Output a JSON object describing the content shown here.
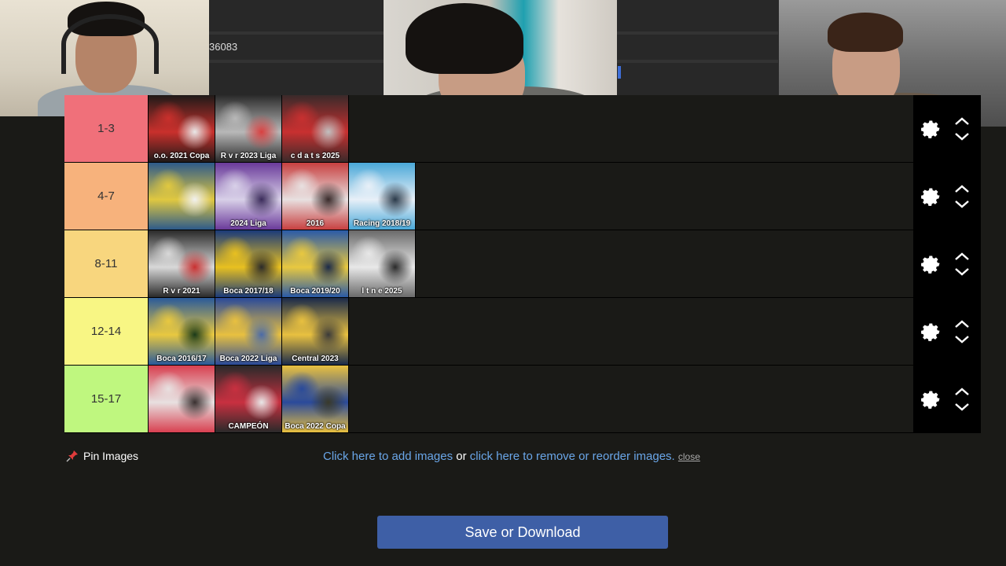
{
  "topbar": {
    "url_fragment": "36083"
  },
  "tiers": [
    {
      "label": "1-3",
      "color": "#f0707a",
      "items": [
        {
          "caption": "o.o. 2021 Copa",
          "palette": [
            "#1f1a18",
            "#c9302c",
            "#e8e8e8"
          ]
        },
        {
          "caption": "R v r 2023 Liga",
          "palette": [
            "#2a2a2a",
            "#b8b8b8",
            "#d84040"
          ]
        },
        {
          "caption": "c d a t s 2025",
          "palette": [
            "#3a2a2a",
            "#c83030",
            "#c0c0c0"
          ]
        }
      ]
    },
    {
      "label": "4-7",
      "color": "#f7b27c",
      "items": [
        {
          "caption": "",
          "palette": [
            "#2d5a8a",
            "#e0c840",
            "#f0f0f0"
          ]
        },
        {
          "caption": "2024 Liga",
          "palette": [
            "#6a3a9a",
            "#d8d0e8",
            "#3a2a5a"
          ]
        },
        {
          "caption": "2016",
          "palette": [
            "#c84040",
            "#e8e0e0",
            "#3a2a2a"
          ]
        },
        {
          "caption": "Racing 2018/19",
          "palette": [
            "#4aa8d8",
            "#e8f0f8",
            "#2a3a4a"
          ]
        }
      ]
    },
    {
      "label": "8-11",
      "color": "#f8d67e",
      "items": [
        {
          "caption": "R v r 2021",
          "palette": [
            "#2a2a2a",
            "#d8d8d8",
            "#c83030"
          ]
        },
        {
          "caption": "Boca 2017/18",
          "palette": [
            "#1a3a7a",
            "#e8c020",
            "#2a2a2a"
          ]
        },
        {
          "caption": "Boca 2019/20",
          "palette": [
            "#2a5aa8",
            "#e8c840",
            "#1a2a4a"
          ]
        },
        {
          "caption": "l t n e 2025",
          "palette": [
            "#6a6a6a",
            "#e8e8e8",
            "#2a2a2a"
          ]
        }
      ]
    },
    {
      "label": "12-14",
      "color": "#f8f684",
      "items": [
        {
          "caption": "Boca 2016/17",
          "palette": [
            "#2a5a9a",
            "#e8c840",
            "#1a3a1a"
          ]
        },
        {
          "caption": "Boca 2022 Liga",
          "palette": [
            "#2a4a9a",
            "#e8c040",
            "#4a6aa8"
          ]
        },
        {
          "caption": "Central 2023",
          "palette": [
            "#1a2a4a",
            "#e8c040",
            "#3a3a3a"
          ]
        }
      ]
    },
    {
      "label": "15-17",
      "color": "#bff77f",
      "items": [
        {
          "caption": "",
          "palette": [
            "#d84050",
            "#e8e0e0",
            "#3a3030"
          ]
        },
        {
          "caption": "CAMPEÓN",
          "palette": [
            "#2a2a2a",
            "#c83040",
            "#e8e8e8"
          ]
        },
        {
          "caption": "Boca 2022 Copa",
          "palette": [
            "#e8c040",
            "#2a4a9a",
            "#3a3a2a"
          ]
        }
      ]
    }
  ],
  "pin_images": {
    "icon": "pushpin-icon",
    "label": "Pin Images"
  },
  "image_links": {
    "add": "Click here to add images",
    "or": " or ",
    "remove": "click here to remove or reorder images.",
    "close": "close"
  },
  "save_button": "Save or Download"
}
